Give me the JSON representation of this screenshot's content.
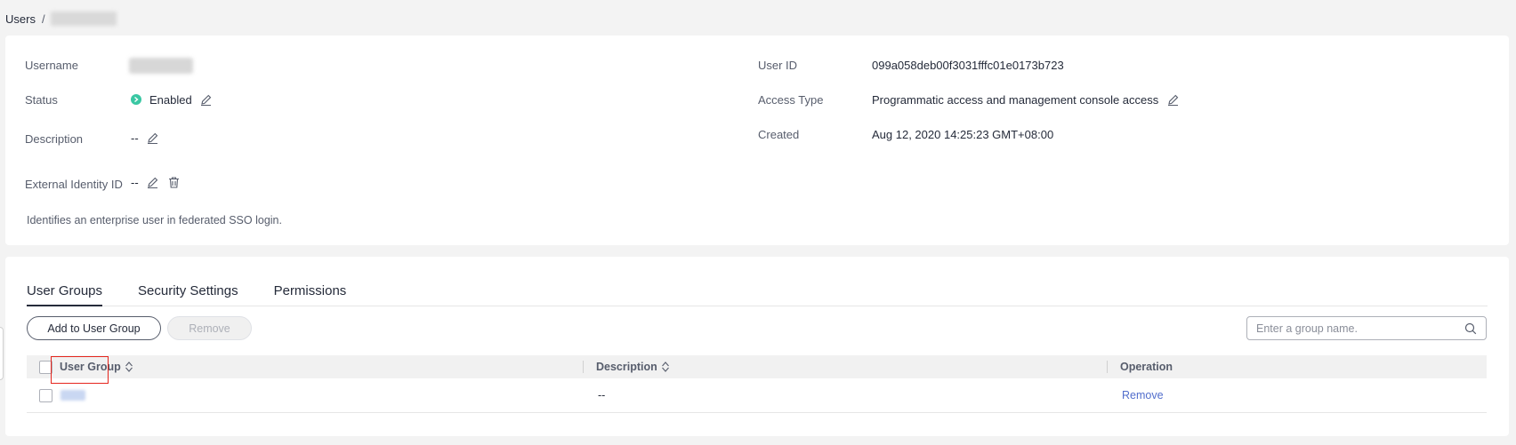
{
  "breadcrumb": {
    "root": "Users",
    "separator": "/"
  },
  "info": {
    "username_label": "Username",
    "status_label": "Status",
    "status_value": "Enabled",
    "description_label": "Description",
    "description_value": "--",
    "external_id_label": "External Identity ID",
    "external_id_value": "--",
    "external_id_hint": "Identifies an enterprise user in federated SSO login.",
    "user_id_label": "User ID",
    "user_id_value": "099a058deb00f3031fffc01e0173b723",
    "access_type_label": "Access Type",
    "access_type_value": "Programmatic access and management console access",
    "created_label": "Created",
    "created_value": "Aug 12, 2020 14:25:23 GMT+08:00"
  },
  "tabs": [
    "User Groups",
    "Security Settings",
    "Permissions"
  ],
  "toolbar": {
    "add_label": "Add to User Group",
    "remove_label": "Remove",
    "search_placeholder": "Enter a group name."
  },
  "table": {
    "columns": [
      "User Group",
      "Description",
      "Operation"
    ],
    "rows": [
      {
        "description": "--",
        "operation": "Remove"
      }
    ]
  },
  "colors": {
    "status_enabled": "#3ac7a3",
    "link": "#526ecc",
    "highlight_border": "#e5251d"
  },
  "icons": [
    "edit-icon",
    "delete-icon",
    "search-icon",
    "sort-icon",
    "status-enabled-icon"
  ]
}
